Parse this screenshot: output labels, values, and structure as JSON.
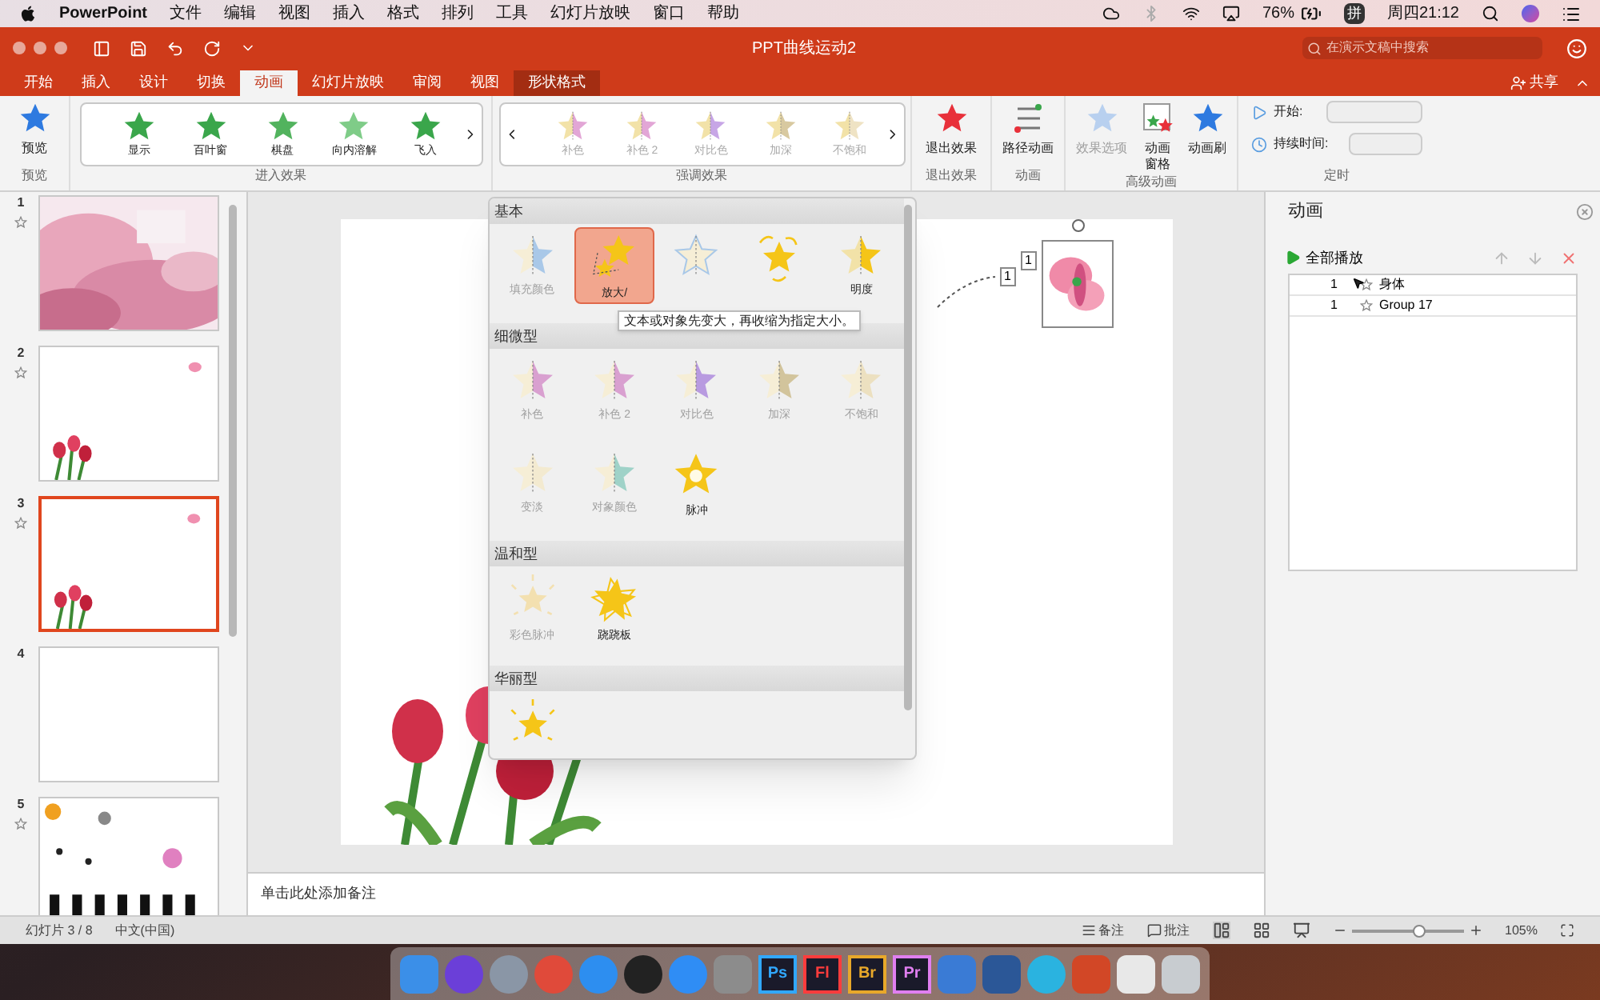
{
  "menu_bar": {
    "app": "PowerPoint",
    "items": [
      "文件",
      "编辑",
      "视图",
      "插入",
      "格式",
      "排列",
      "工具",
      "幻灯片放映",
      "窗口",
      "帮助"
    ],
    "battery": "76%",
    "input_method": "拼",
    "clock": "周四21:12"
  },
  "window": {
    "title": "PPT曲线运动2",
    "search": {
      "placeholder": "在演示文稿中搜索"
    },
    "share": "共享"
  },
  "tabs": [
    {
      "label": "开始",
      "selected": false,
      "kind": "normal"
    },
    {
      "label": "插入",
      "selected": false,
      "kind": "normal"
    },
    {
      "label": "设计",
      "selected": false,
      "kind": "normal"
    },
    {
      "label": "切换",
      "selected": false,
      "kind": "normal"
    },
    {
      "label": "动画",
      "selected": true,
      "kind": "normal"
    },
    {
      "label": "幻灯片放映",
      "selected": false,
      "kind": "normal"
    },
    {
      "label": "审阅",
      "selected": false,
      "kind": "normal"
    },
    {
      "label": "视图",
      "selected": false,
      "kind": "normal"
    },
    {
      "label": "形状格式",
      "selected": false,
      "kind": "contextual"
    }
  ],
  "ribbon": {
    "preview": {
      "label": "预览",
      "group": "预览"
    },
    "entrance": {
      "group": "进入效果",
      "items": [
        {
          "label": "显示",
          "color": "#3aa64b"
        },
        {
          "label": "百叶窗",
          "color": "#3aa64b"
        },
        {
          "label": "棋盘",
          "color": "#52b35e"
        },
        {
          "label": "向内溶解",
          "color": "#7fcc88"
        },
        {
          "label": "飞入",
          "color": "#3aa64b"
        }
      ]
    },
    "emphasis": {
      "group": "强调效果",
      "items": [
        {
          "label": "补色",
          "color": "#e2a6d6"
        },
        {
          "label": "补色 2",
          "color": "#e2a6d6"
        },
        {
          "label": "对比色",
          "color": "#c7a6e6"
        },
        {
          "label": "加深",
          "color": "#d8c9a0"
        },
        {
          "label": "不饱和",
          "color": "#efe3c4"
        }
      ]
    },
    "exit": {
      "label": "退出效果",
      "group": "退出效果"
    },
    "path": {
      "label": "路径动画",
      "group": "动画"
    },
    "advanced": {
      "group": "高级动画",
      "items": [
        {
          "label": "效果选项",
          "disabled": true,
          "kind": "options"
        },
        {
          "label": "动画窗格",
          "disabled": false,
          "kind": "pane"
        },
        {
          "label": "动画刷",
          "disabled": false,
          "kind": "brush"
        }
      ]
    },
    "timing": {
      "group": "定时",
      "start_label": "开始:",
      "duration_label": "持续时间:"
    }
  },
  "slides": [
    {
      "number": "1",
      "animated": true,
      "kind": "blossom",
      "selected": false
    },
    {
      "number": "2",
      "animated": true,
      "kind": "tulip",
      "selected": false
    },
    {
      "number": "3",
      "animated": true,
      "kind": "tulip",
      "selected": true
    },
    {
      "number": "4",
      "animated": false,
      "kind": "blank",
      "selected": false
    },
    {
      "number": "5",
      "animated": true,
      "kind": "music",
      "selected": false
    }
  ],
  "slide_canvas": {
    "tags": [
      "1",
      "1"
    ]
  },
  "notes": {
    "placeholder": "单击此处添加备注"
  },
  "effect_gallery": {
    "sections": [
      {
        "title": "基本",
        "items": [
          {
            "label": "填充颜色",
            "selected": false,
            "disabled": true,
            "kind": "half",
            "color": "#a9c8e8"
          },
          {
            "label": "放大/",
            "selected": true,
            "disabled": false,
            "kind": "grow",
            "color": "#f5c518"
          },
          {
            "selected": false,
            "disabled": true,
            "kind": "outline",
            "color": "#a9c8e8"
          },
          {
            "selected": false,
            "kind": "spin",
            "color": "#f5c518"
          },
          {
            "label": "明度",
            "selected": false,
            "disabled": false,
            "kind": "half",
            "color": "#f5c518"
          }
        ]
      },
      {
        "title": "细微型",
        "items": [
          {
            "label": "补色",
            "selected": false,
            "disabled": true,
            "kind": "half",
            "color": "#d9a0d0"
          },
          {
            "label": "补色 2",
            "selected": false,
            "disabled": true,
            "kind": "half",
            "color": "#d9a0d0"
          },
          {
            "label": "对比色",
            "selected": false,
            "disabled": true,
            "kind": "half",
            "color": "#b89ae0"
          },
          {
            "label": "加深",
            "selected": false,
            "disabled": true,
            "kind": "half",
            "color": "#d2c49c"
          },
          {
            "label": "不饱和",
            "selected": false,
            "disabled": true,
            "kind": "half",
            "color": "#ece0c0"
          },
          {
            "label": "变淡",
            "selected": false,
            "disabled": true,
            "kind": "half",
            "color": "#f3ead0"
          },
          {
            "label": "对象颜色",
            "selected": false,
            "disabled": true,
            "kind": "half",
            "color": "#9fd2c8"
          },
          {
            "label": "脉冲",
            "selected": false,
            "disabled": false,
            "kind": "glow",
            "color": "#f5c518"
          }
        ]
      },
      {
        "title": "温和型",
        "items": [
          {
            "label": "彩色脉冲",
            "selected": false,
            "disabled": true,
            "kind": "burst",
            "color": "#f3e0b0"
          },
          {
            "label": "跷跷板",
            "selected": false,
            "disabled": false,
            "kind": "wobble",
            "color": "#f5c518"
          }
        ]
      },
      {
        "title": "华丽型",
        "items": [
          {
            "selected": false,
            "kind": "burst",
            "color": "#f5c518"
          }
        ]
      }
    ],
    "tooltip": "文本或对象先变大，再收缩为指定大小。"
  },
  "animation_pane": {
    "title": "动画",
    "play_all": "全部播放",
    "items": [
      {
        "order": "1",
        "name": "身体",
        "selected": false
      },
      {
        "order": "1",
        "name": "Group 17",
        "selected": false
      }
    ]
  },
  "status_bar": {
    "slide": "幻灯片 3 / 8",
    "language": "中文(中国)",
    "notes": "备注",
    "comments": "批注",
    "zoom": "105%",
    "level": 0.6
  },
  "dock": [
    {
      "kind": "finder",
      "color": "#3b8fe8"
    },
    {
      "kind": "siri",
      "color": "#6b3fd8"
    },
    {
      "kind": "launchpad",
      "color": "#8a96a6"
    },
    {
      "kind": "chrome",
      "color": "#e04a3a"
    },
    {
      "kind": "safari",
      "color": "#2d8ef0"
    },
    {
      "kind": "qq",
      "color": "#222222"
    },
    {
      "kind": "appstore",
      "color": "#2f8df5"
    },
    {
      "kind": "settings",
      "color": "#8c8c8c"
    },
    {
      "kind": "letter",
      "color": "#31a8ff",
      "label": "Ps"
    },
    {
      "kind": "letter",
      "color": "#ff3c3c",
      "label": "Fl"
    },
    {
      "kind": "letter",
      "color": "#e8a82a",
      "label": "Br"
    },
    {
      "kind": "letter",
      "color": "#e07ff0",
      "label": "Pr"
    },
    {
      "kind": "quicktime",
      "color": "#3a7bd5"
    },
    {
      "kind": "word",
      "color": "#2b5797"
    },
    {
      "kind": "circle",
      "color": "#2ab3e0"
    },
    {
      "kind": "powerpoint",
      "color": "#d24726"
    },
    {
      "kind": "preview",
      "color": "#e8e8e8"
    },
    {
      "kind": "trash",
      "color": "#c8ccd0"
    }
  ]
}
